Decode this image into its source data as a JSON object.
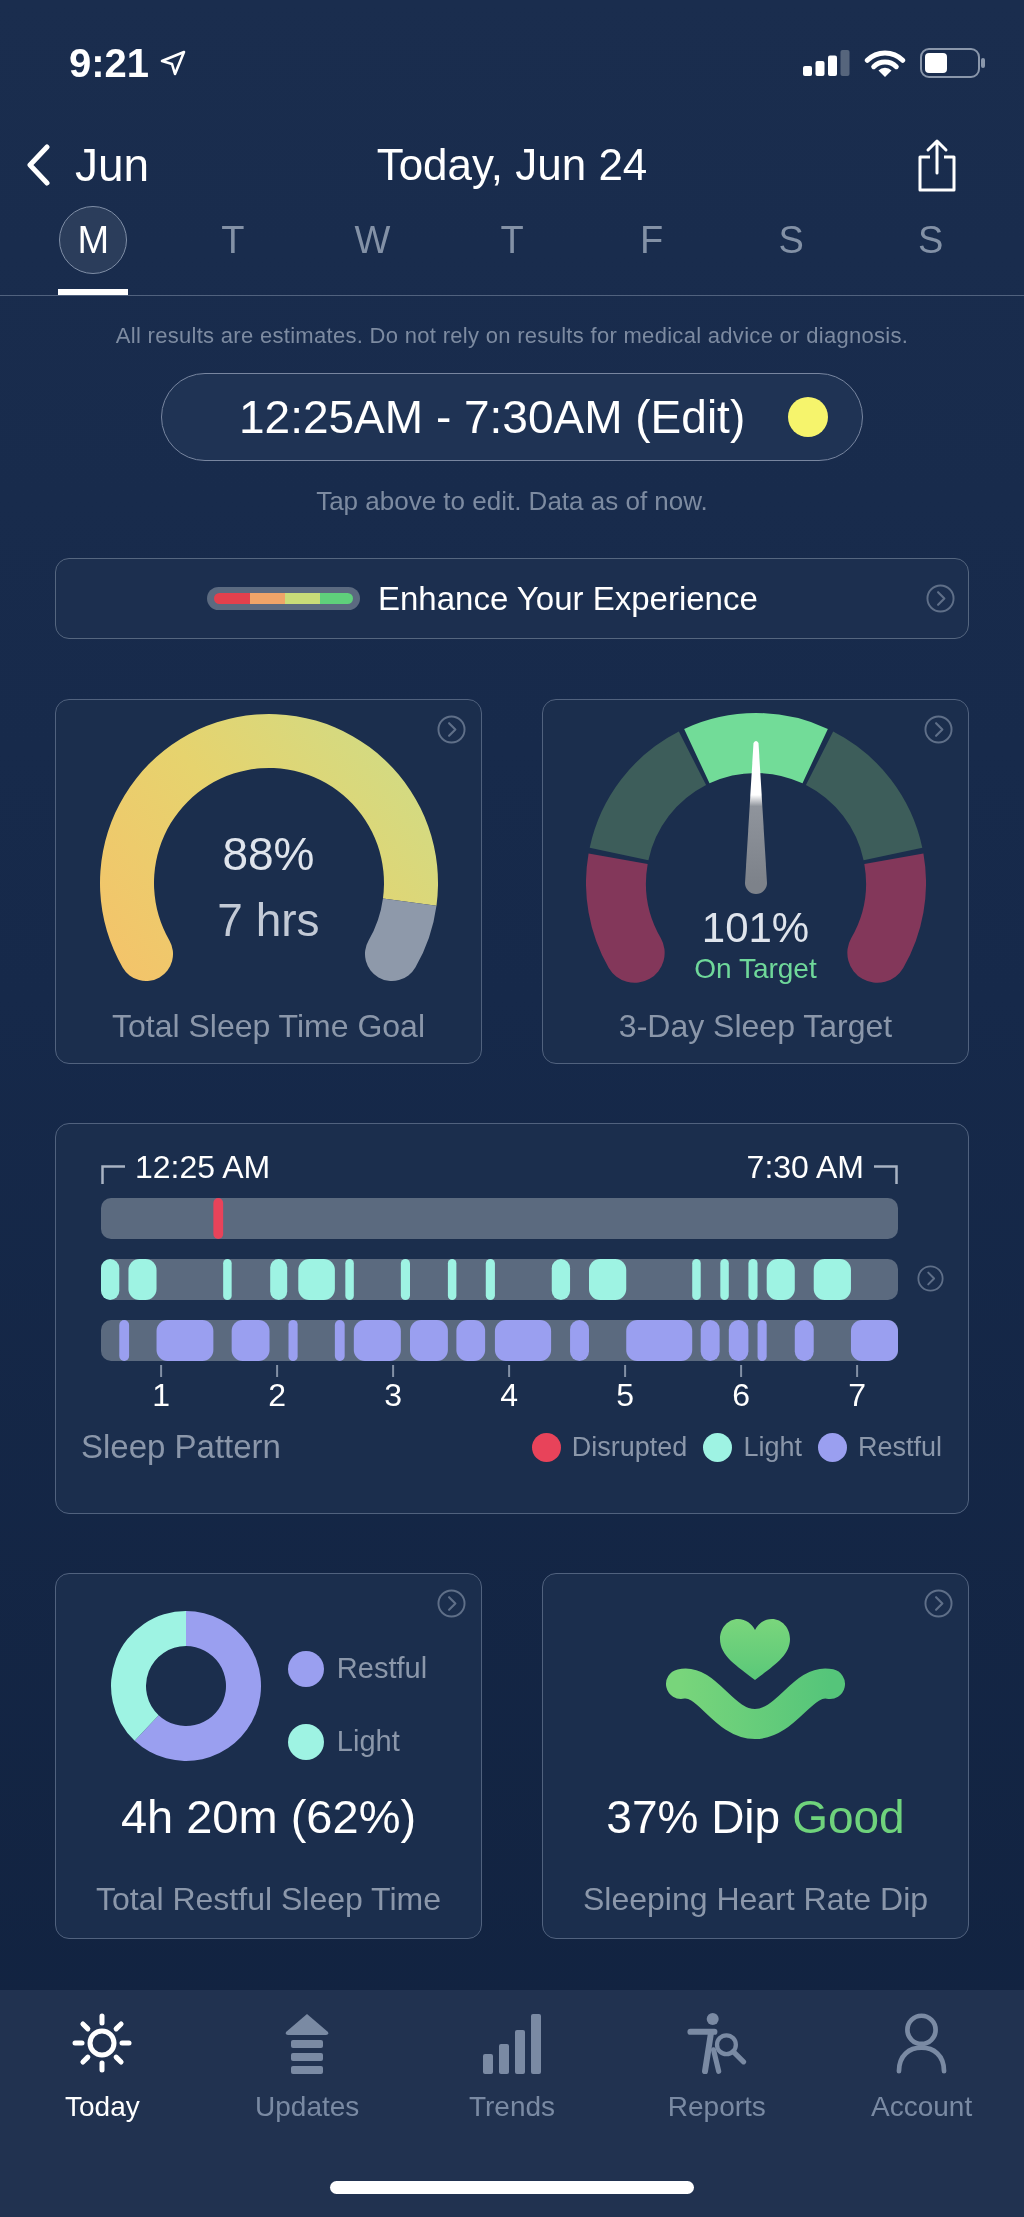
{
  "status_bar": {
    "time": "9:21"
  },
  "header": {
    "back_label": "Jun",
    "title": "Today, Jun 24"
  },
  "days": [
    {
      "label": "M",
      "selected": true
    },
    {
      "label": "T",
      "selected": false
    },
    {
      "label": "W",
      "selected": false
    },
    {
      "label": "T",
      "selected": false
    },
    {
      "label": "F",
      "selected": false
    },
    {
      "label": "S",
      "selected": false
    },
    {
      "label": "S",
      "selected": false
    }
  ],
  "disclaimer": "All results are estimates. Do not rely on results for medical advice or diagnosis.",
  "sleep_window": {
    "label": "12:25AM - 7:30AM (Edit)"
  },
  "edit_hint": "Tap above to edit. Data as of now.",
  "enhance": {
    "label": "Enhance Your Experience"
  },
  "sleep_goal": {
    "chart_data": {
      "type": "donut",
      "values": [
        88,
        12
      ]
    },
    "value": "88%",
    "hours": "7 hrs",
    "title": "Total Sleep Time Goal"
  },
  "sleep_target": {
    "value": "101%",
    "status": "On Target",
    "level": 0.5,
    "title": "3-Day Sleep Target"
  },
  "sleep_pattern": {
    "start": "12:25 AM",
    "end": "7:30 AM",
    "hours": [
      "1",
      "2",
      "3",
      "4",
      "5",
      "6",
      "7"
    ],
    "title": "Sleep Pattern",
    "legend": [
      {
        "label": "Disrupted",
        "color": "#e8435a"
      },
      {
        "label": "Light",
        "color": "#9ef3e3"
      },
      {
        "label": "Restful",
        "color": "#9a9ff0"
      }
    ]
  },
  "restful_sleep": {
    "chart_data": {
      "type": "donut",
      "categories": [
        "Restful",
        "Light"
      ],
      "values": [
        62,
        38
      ]
    },
    "legend": [
      {
        "color": "#9a9ff0"
      },
      {
        "color": "#9ef3e3"
      }
    ],
    "value": "4h 20m (62%)",
    "title": "Total Restful Sleep Time"
  },
  "heart_rate_dip": {
    "value": "37% Dip",
    "rating": "Good",
    "title": "Sleeping Heart Rate Dip"
  },
  "tab_bar": [
    {
      "label": "Today",
      "selected": true
    },
    {
      "label": "Updates",
      "selected": false
    },
    {
      "label": "Trends",
      "selected": false
    },
    {
      "label": "Reports",
      "selected": false
    },
    {
      "label": "Account",
      "selected": false
    }
  ]
}
